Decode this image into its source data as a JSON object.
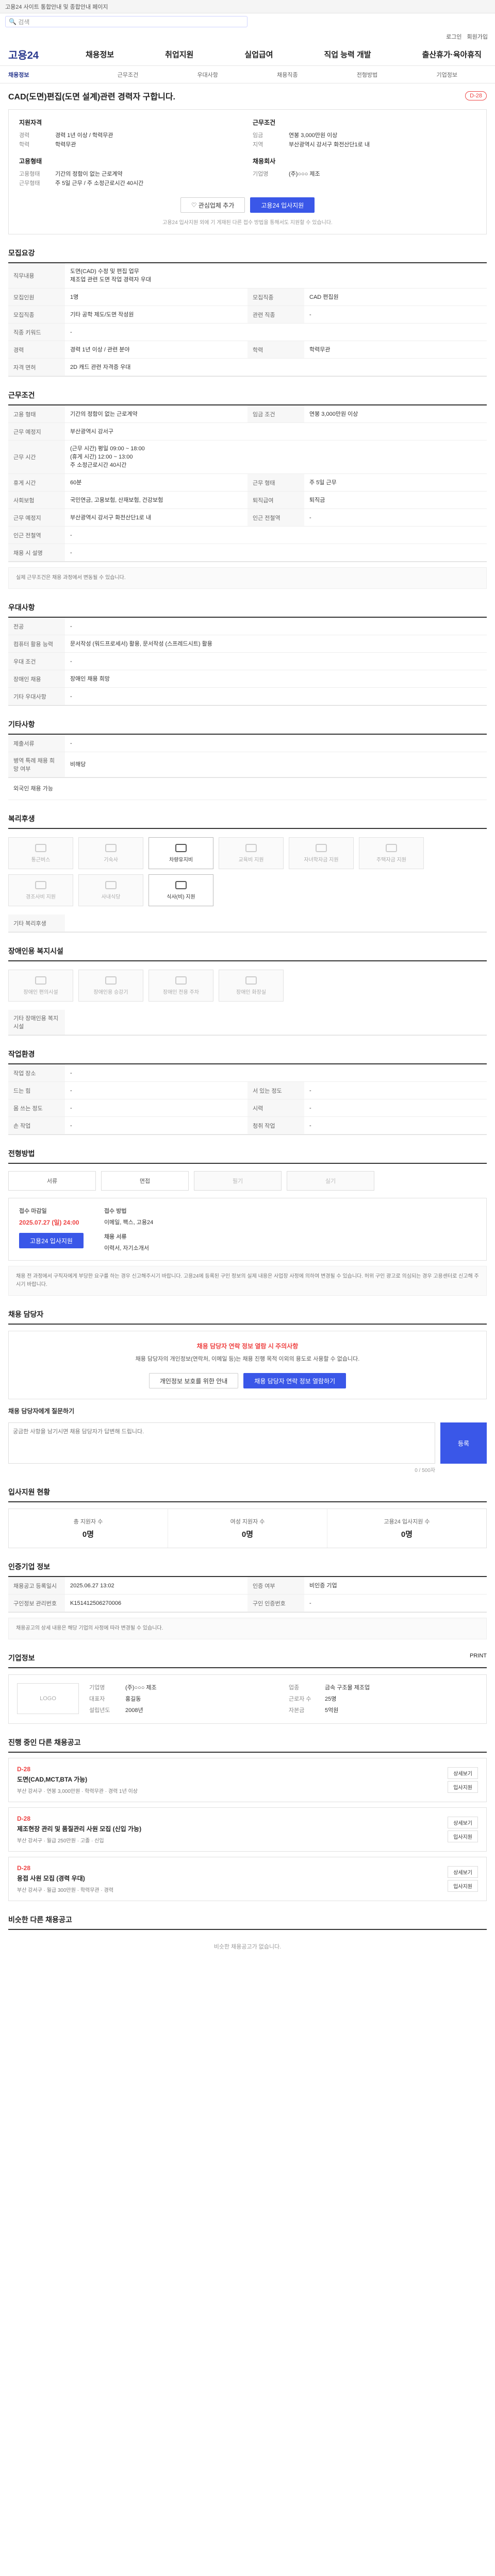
{
  "topbar": {
    "notice": "고용24 사이트 통합안내 및 종합안내 페이지"
  },
  "search": {
    "placeholder": "검색"
  },
  "util": {
    "login": "로그인",
    "signup": "회원가입"
  },
  "brand": {
    "logo": "고용24"
  },
  "nav": [
    "채용정보",
    "취업지원",
    "실업급여",
    "직업 능력 개발",
    "출산휴가·육아휴직"
  ],
  "subnav": [
    "채용정보",
    "근무조건",
    "우대사항",
    "채용직종",
    "전형방법",
    "기업정보"
  ],
  "job": {
    "title": "CAD(도면)편집(도면 설계)관련 경력자 구합니다.",
    "dday": "D-28"
  },
  "summary": {
    "left_title": "지원자격",
    "left": [
      {
        "k": "경력",
        "v": "경력 1년 이상 / 학력무관"
      },
      {
        "k": "학력",
        "v": "학력무관"
      }
    ],
    "left2_title": "고용형태",
    "left2": [
      {
        "k": "고용형태",
        "v": "기간의 정함이 없는 근로계약"
      },
      {
        "k": "근무형태",
        "v": "주 5일 근무 / 주 소정근로시간 40시간"
      }
    ],
    "right_title": "근무조건",
    "right": [
      {
        "k": "임금",
        "v": "연봉 3,000만원 이상"
      },
      {
        "k": "지역",
        "v": "부산광역시 강서구 화전산단1로 내"
      }
    ],
    "right2_title": "채용회사",
    "right2": [
      {
        "k": "기업명",
        "v": "(주)○○○ 제조"
      }
    ],
    "scrap_label": "관심업체 추가",
    "apply_label": "고용24 입사지원",
    "note": "고용24 입사지원 외에 기 게재된 다른 접수 방법을 통해서도 지원할 수 있습니다."
  },
  "sections": {
    "recruit": "모집요강",
    "condition": "근무조건",
    "prefer": "우대사항",
    "etc": "기타사항",
    "welfare": "복리후생",
    "disabled": "장애인용 복지시설",
    "job_env": "작업환경",
    "process": "전형방법",
    "report": "채용 담당자",
    "apply_stats": "입사지원 현황",
    "rec_info": "인증기업 정보",
    "company": "기업정보",
    "ongoing": "진행 중인 다른 채용공고",
    "similar": "비슷한 다른 채용공고"
  },
  "recruit": {
    "job_content_label": "직무내용",
    "job_content": "도면(CAD) 수정 및 편집 업무\n제조업 관련 도면 작업 경력자 우대",
    "rows": [
      {
        "k": "모집인원",
        "v": "1명",
        "k2": "모집직종",
        "v2": "CAD 편집원"
      },
      {
        "k": "모집직종",
        "v": "기타 공학 제도/도면 작성원",
        "k2": "관련 직종",
        "v2": "-"
      },
      {
        "k": "직종 키워드",
        "v": "-"
      },
      {
        "k": "경력",
        "v": "경력 1년 이상 / 관련 분야",
        "k2": "학력",
        "v2": "학력무관"
      },
      {
        "k": "자격 면허",
        "v": "2D 캐드 관련 자격증 우대"
      }
    ]
  },
  "condition": {
    "rows": [
      {
        "k": "고용 형태",
        "v": "기간의 정함이 없는 근로계약",
        "k2": "임금 조건",
        "v2": "연봉 3,000만원 이상"
      },
      {
        "k": "근무 예정지",
        "v": "부산광역시 강서구"
      },
      {
        "k": "근무 시간",
        "v": "(근무 시간) 평일 09:00 ~ 18:00\n(휴게 시간) 12:00 ~ 13:00\n주 소정근로시간 40시간"
      },
      {
        "k": "휴게 시간",
        "v": "60분",
        "k2": "근무 형태",
        "v2": "주 5일 근무"
      },
      {
        "k": "사회보험",
        "v": "국민연금, 고용보험, 산재보험, 건강보험",
        "k2": "퇴직급여",
        "v2": "퇴직금"
      },
      {
        "k": "근무 예정지",
        "v": "부산광역시 강서구 화전산단1로 내",
        "k2": "인근 전철역",
        "v2": "-"
      },
      {
        "k": "인근 전철역",
        "v": "-"
      },
      {
        "k": "채용 시 설명",
        "v": "-"
      }
    ],
    "note": "실제 근무조건은 채용 과정에서 변동될 수 있습니다."
  },
  "prefer": {
    "rows": [
      {
        "k": "전공",
        "v": "-"
      },
      {
        "k": "컴퓨터 활용 능력",
        "v": "문서작성 (워드프로세서) 활용, 문서작성 (스프레드시트) 활용"
      },
      {
        "k": "우대 조건",
        "v": "-"
      },
      {
        "k": "장애인 채용",
        "v": "장애인 채용 희망"
      },
      {
        "k": "기타 우대사항",
        "v": "-"
      }
    ]
  },
  "etc": {
    "rows": [
      {
        "k": "제출서류",
        "v": "-"
      },
      {
        "k": "병역 특례 채용 희망 여부",
        "v": "비해당"
      }
    ],
    "more": "외국인 채용 가능"
  },
  "welfare": {
    "items": [
      "통근버스",
      "기숙사",
      "차량유지비",
      "교육비 지원",
      "자녀학자금 지원",
      "주택자금 지원",
      "경조사비 지원",
      "사내식당",
      "식사(비) 지원"
    ],
    "on": [
      2,
      8
    ],
    "etc": "기타 복리후생"
  },
  "disabled_fac": {
    "items": [
      "장애인 편의시설",
      "장애인용 승강기",
      "장애인 전용 주차",
      "장애인 화장실"
    ],
    "etc": "기타 장애인용 복지시설"
  },
  "job_env": {
    "rows": [
      {
        "k": "작업 장소",
        "v": "-",
        "k2": "",
        "v2": ""
      },
      {
        "k": "드는 힘",
        "v": "-",
        "k2": "서 있는 정도",
        "v2": "-"
      },
      {
        "k": "몸 쓰는 정도",
        "v": "-",
        "k2": "시력",
        "v2": "-"
      },
      {
        "k": "손 작업",
        "v": "-",
        "k2": "청취 작업",
        "v2": "-"
      }
    ]
  },
  "process": {
    "methods": [
      "서류",
      "면접",
      "필기",
      "실기"
    ],
    "apply_period_label": "접수 마감일",
    "apply_period": "2025.07.27 (일) 24:00",
    "apply_method_label": "접수 방법",
    "apply_method": "이메일, 팩스, 고용24",
    "contact_label": "채용 서류",
    "contact": "이력서, 자기소개서",
    "apply_button": "고용24 입사지원",
    "notices": "채용 전 과정에서 구직자에게 부당한 요구를 하는 경우 신고해주시기 바랍니다. 고용24에 등록된 구인 정보의 실제 내용은 사업장 사정에 의하여 변경될 수 있습니다. 허위 구인 광고로 의심되는 경우 고용센터로 신고해 주시기 바랍니다."
  },
  "report": {
    "head": "채용 담당자 연락 정보 열람 시 주의사항",
    "body": "채용 담당자의 개인정보(연락처, 이메일 등)는 채용 진행 목적 이외의 용도로 사용할 수 없습니다.",
    "view_btn": "개인정보 보호를 위한 안내",
    "contact_btn": "채용 담당자 연락 정보 열람하기",
    "qa_title": "채용 담당자에게 질문하기",
    "qa_placeholder": "궁금한 사항을 남기시면 채용 담당자가 답변해 드립니다.",
    "qa_send": "등록",
    "qa_count": "0 / 500자"
  },
  "apply_stats": {
    "items": [
      {
        "label": "총 지원자 수",
        "value": "0명"
      },
      {
        "label": "여성 지원자 수",
        "value": "0명"
      },
      {
        "label": "고용24 입사지원 수",
        "value": "0명"
      }
    ]
  },
  "rec_info": {
    "rows": [
      {
        "k": "채용공고 등록일시",
        "v": "2025.06.27 13:02",
        "k2": "인증 여부",
        "v2": "비인증 기업"
      },
      {
        "k": "구인정보 관리번호",
        "v": "K151412506270006",
        "k2": "구인 인증번호",
        "v2": "-"
      }
    ],
    "note": "채용공고의 상세 내용은 해당 기업의 사정에 따라 변경될 수 있습니다."
  },
  "company": {
    "logo": "LOGO",
    "name": "(주)○○○ 제조",
    "rows": [
      {
        "k": "기업명",
        "v": "(주)○○○ 제조"
      },
      {
        "k": "업종",
        "v": "금속 구조물 제조업"
      },
      {
        "k": "대표자",
        "v": "홍길동"
      },
      {
        "k": "근로자 수",
        "v": "25명"
      },
      {
        "k": "설립년도",
        "v": "2008년"
      },
      {
        "k": "자본금",
        "v": "5억원"
      }
    ],
    "print": "PRINT"
  },
  "ongoing": [
    {
      "dday": "D-28",
      "title": "도면(CAD,MCT,BTA 가능)",
      "region": "부산 강서구",
      "pay": "연봉 3,000만원",
      "edu": "학력무관",
      "career": "경력 1년 이상"
    },
    {
      "dday": "D-28",
      "title": "제조현장 관리 및 품질관리 사원 모집 (신입 가능)",
      "region": "부산 강서구",
      "pay": "월급 250만원",
      "edu": "고졸",
      "career": "신입"
    },
    {
      "dday": "D-28",
      "title": "용접 사원 모집 (경력 우대)",
      "region": "부산 강서구",
      "pay": "월급 300만원",
      "edu": "학력무관",
      "career": "경력"
    }
  ],
  "ongoing_btns": {
    "detail": "상세보기",
    "apply": "입사지원"
  },
  "similar": {
    "empty": "비슷한 채용공고가 없습니다."
  },
  "colors": {
    "primary": "#3a57e8",
    "accent": "#e44444"
  }
}
